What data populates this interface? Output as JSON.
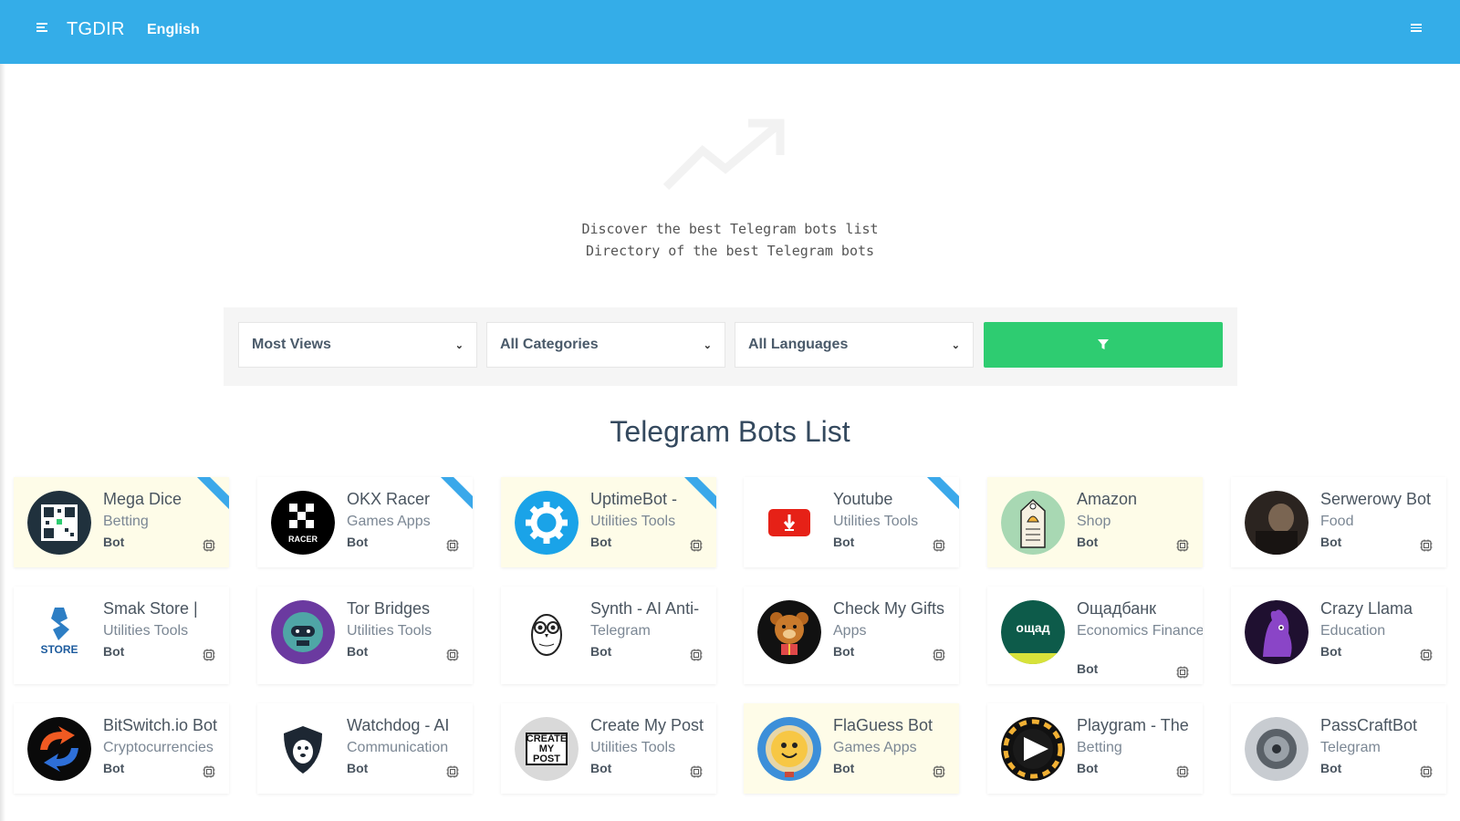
{
  "header": {
    "brand": "TGDIR",
    "language": "English",
    "background": "#34ade8"
  },
  "hero": {
    "line1": "Discover the best Telegram bots list",
    "line2": "Directory of the best Telegram bots"
  },
  "filters": {
    "sort_selected": "Most Views",
    "category_selected": "All Categories",
    "language_selected": "All Languages",
    "button_icon": "filter-icon",
    "button_color": "#2ecc71"
  },
  "section_title": "Telegram Bots List",
  "cards": [
    {
      "title": "Mega Dice",
      "category": "Betting",
      "type": "Bot",
      "featured": true,
      "ribbon": true,
      "icon": "qr-code-icon"
    },
    {
      "title": "OKX Racer",
      "category": "Games Apps",
      "type": "Bot",
      "featured": false,
      "ribbon": true,
      "icon": "okx-racer-logo"
    },
    {
      "title": "UptimeBot -",
      "category": "Utilities Tools",
      "type": "Bot",
      "featured": true,
      "ribbon": true,
      "icon": "gear-logo"
    },
    {
      "title": "Youtube",
      "category": "Utilities Tools",
      "type": "Bot",
      "featured": false,
      "ribbon": true,
      "icon": "youtube-download-logo"
    },
    {
      "title": "Amazon",
      "category": "Shop",
      "type": "Bot",
      "featured": true,
      "ribbon": false,
      "icon": "price-tag-bell-logo"
    },
    {
      "title": "Serwerowy Bot",
      "category": "Food",
      "type": "Bot",
      "featured": false,
      "ribbon": false,
      "icon": "photo-avatar"
    },
    {
      "title": "Smak Store |",
      "category": "Utilities Tools",
      "type": "Bot",
      "featured": false,
      "ribbon": false,
      "icon": "store-logo"
    },
    {
      "title": "Tor Bridges",
      "category": "Utilities Tools",
      "type": "Bot",
      "featured": false,
      "ribbon": false,
      "icon": "robot-logo"
    },
    {
      "title": "Synth - AI Anti-",
      "category": "Telegram",
      "type": "Bot",
      "featured": false,
      "ribbon": false,
      "icon": "owl-logo"
    },
    {
      "title": "Check My Gifts",
      "category": "Apps",
      "type": "Bot",
      "featured": false,
      "ribbon": false,
      "icon": "teddy-bear-logo"
    },
    {
      "title": "Ощадбанк",
      "category": "Economics Finance",
      "type": "Bot",
      "featured": false,
      "ribbon": false,
      "icon": "oschad-logo",
      "logo_text": "ощад"
    },
    {
      "title": "Crazy Llama",
      "category": "Education",
      "type": "Bot",
      "featured": false,
      "ribbon": false,
      "icon": "llama-logo"
    },
    {
      "title": "BitSwitch.io Bot",
      "category": "Cryptocurrencies",
      "type": "Bot",
      "featured": false,
      "ribbon": false,
      "icon": "bitswitch-logo"
    },
    {
      "title": "Watchdog - AI",
      "category": "Communication",
      "type": "Bot",
      "featured": false,
      "ribbon": false,
      "icon": "dog-shield-logo"
    },
    {
      "title": "Create My Post",
      "category": "Utilities Tools",
      "type": "Bot",
      "featured": false,
      "ribbon": false,
      "icon": "create-my-post-logo",
      "logo_text": "CREATE MY POST"
    },
    {
      "title": "FlaGuess Bot",
      "category": "Games Apps",
      "type": "Bot",
      "featured": true,
      "ribbon": false,
      "icon": "globe-logo"
    },
    {
      "title": "Playgram - The",
      "category": "Betting",
      "type": "Bot",
      "featured": false,
      "ribbon": false,
      "icon": "play-chip-logo"
    },
    {
      "title": "PassCraftBot",
      "category": "Telegram",
      "type": "Bot",
      "featured": false,
      "ribbon": false,
      "icon": "vault-logo"
    }
  ]
}
